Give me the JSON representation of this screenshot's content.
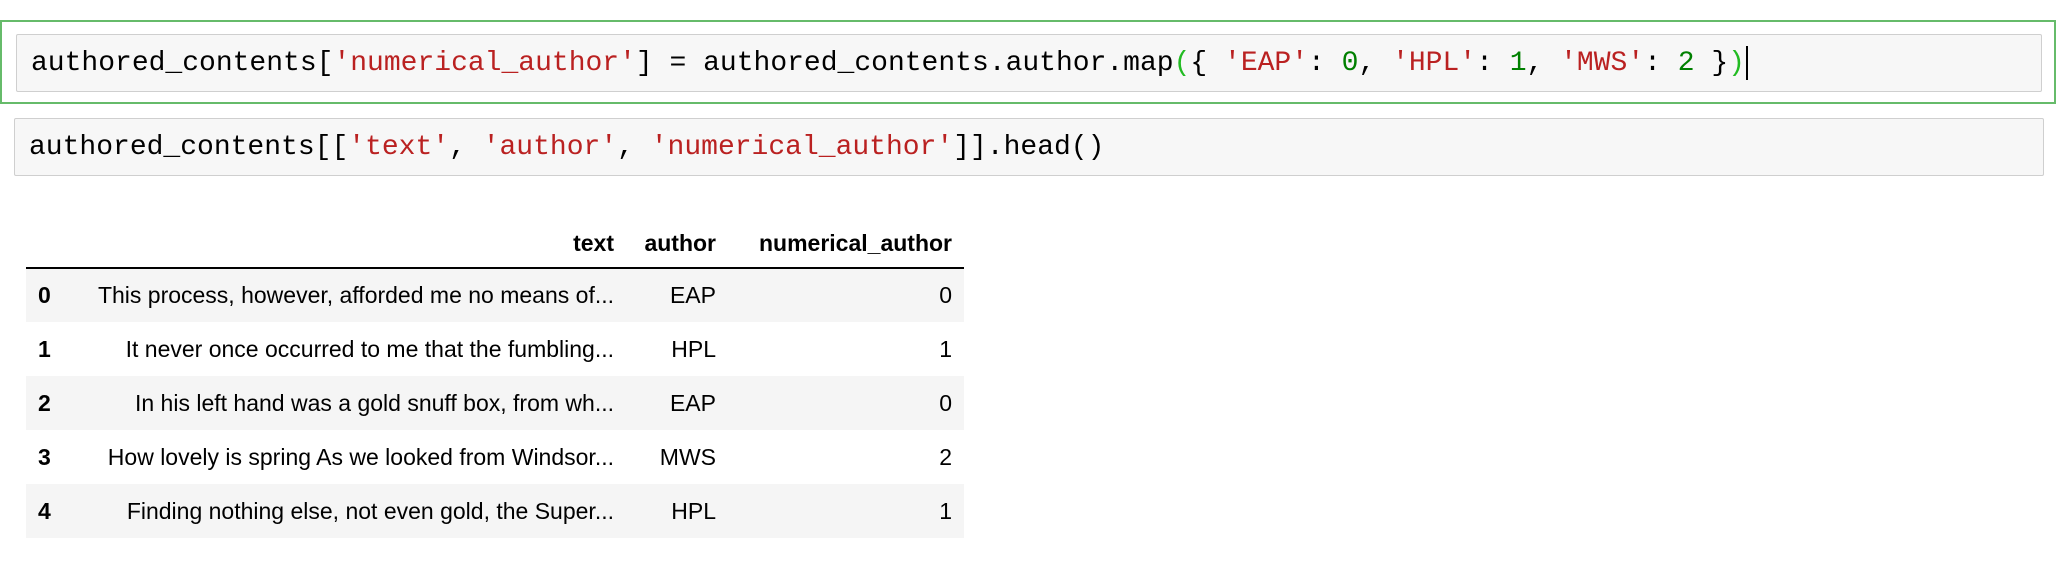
{
  "cells": [
    {
      "segments": [
        {
          "text": "authored_contents[",
          "type": "plain"
        },
        {
          "text": "'numerical_author'",
          "type": "str"
        },
        {
          "text": "] = authored_contents.author.map",
          "type": "plain"
        },
        {
          "text": "(",
          "type": "bracket"
        },
        {
          "text": "{ ",
          "type": "plain"
        },
        {
          "text": "'EAP'",
          "type": "str"
        },
        {
          "text": ": ",
          "type": "plain"
        },
        {
          "text": "0",
          "type": "num"
        },
        {
          "text": ", ",
          "type": "plain"
        },
        {
          "text": "'HPL'",
          "type": "str"
        },
        {
          "text": ": ",
          "type": "plain"
        },
        {
          "text": "1",
          "type": "num"
        },
        {
          "text": ", ",
          "type": "plain"
        },
        {
          "text": "'MWS'",
          "type": "str"
        },
        {
          "text": ": ",
          "type": "plain"
        },
        {
          "text": "2",
          "type": "num"
        },
        {
          "text": " }",
          "type": "plain"
        },
        {
          "text": ")",
          "type": "bracket"
        }
      ]
    },
    {
      "segments": [
        {
          "text": "authored_contents[[",
          "type": "plain"
        },
        {
          "text": "'text'",
          "type": "str"
        },
        {
          "text": ", ",
          "type": "plain"
        },
        {
          "text": "'author'",
          "type": "str"
        },
        {
          "text": ", ",
          "type": "plain"
        },
        {
          "text": "'numerical_author'",
          "type": "str"
        },
        {
          "text": "]].head()",
          "type": "plain"
        }
      ]
    }
  ],
  "output_table": {
    "columns": [
      "",
      "text",
      "author",
      "numerical_author"
    ],
    "rows": [
      {
        "index": "0",
        "text": "This process, however, afforded me no means of...",
        "author": "EAP",
        "numerical_author": "0"
      },
      {
        "index": "1",
        "text": "It never once occurred to me that the fumbling...",
        "author": "HPL",
        "numerical_author": "1"
      },
      {
        "index": "2",
        "text": "In his left hand was a gold snuff box, from wh...",
        "author": "EAP",
        "numerical_author": "0"
      },
      {
        "index": "3",
        "text": "How lovely is spring As we looked from Windsor...",
        "author": "MWS",
        "numerical_author": "2"
      },
      {
        "index": "4",
        "text": "Finding nothing else, not even gold, the Super...",
        "author": "HPL",
        "numerical_author": "1"
      }
    ]
  },
  "colors": {
    "string": "#ba2121",
    "number": "#008000",
    "matched_bracket": "#22bb22",
    "selected_cell_border": "#66bb6a"
  }
}
